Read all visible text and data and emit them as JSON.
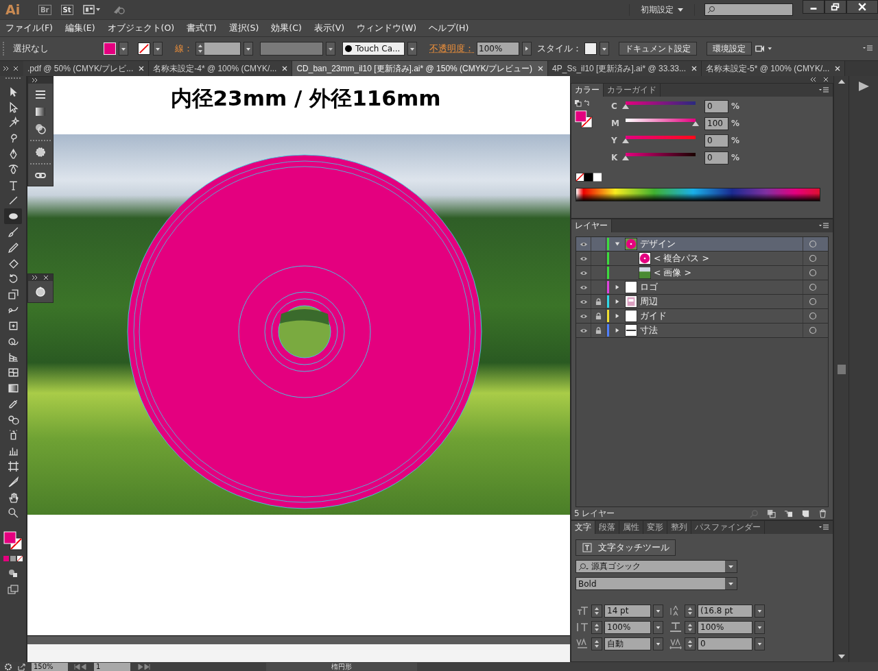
{
  "app_bar": {
    "logo": "Ai",
    "apps": [
      "Br",
      "St"
    ],
    "workspace": "初期設定"
  },
  "menu": [
    "ファイル(F)",
    "編集(E)",
    "オブジェクト(O)",
    "書式(T)",
    "選択(S)",
    "効果(C)",
    "表示(V)",
    "ウィンドウ(W)",
    "ヘルプ(H)"
  ],
  "control_bar": {
    "selection": "選択なし",
    "stroke_label": "線：",
    "brush": "Touch Ca...",
    "opacity_label": "不透明度：",
    "opacity": "100%",
    "style_label": "スタイル：",
    "buttons": [
      "ドキュメント設定",
      "環境設定"
    ]
  },
  "doc_tabs": [
    {
      "label": ".pdf @ 50% (CMYK/プレビ...",
      "selected": false
    },
    {
      "label": "名称未設定-4* @ 100% (CMYK/...",
      "selected": false
    },
    {
      "label": "CD_ban_23mm_il10 [更新済み].ai* @ 150% (CMYK/プレビュー)",
      "selected": true
    },
    {
      "label": "4P_Ss_il10 [更新済み].ai* @ 33.33...",
      "selected": false
    },
    {
      "label": "名称未設定-5* @ 100% (CMYK/...",
      "selected": false
    }
  ],
  "artboard": {
    "title": "内径23mm / 外径116mm"
  },
  "color_panel": {
    "tabs": [
      {
        "label": "カラー",
        "selected": true
      },
      {
        "label": "カラーガイド",
        "selected": false
      }
    ],
    "channels": [
      {
        "name": "C",
        "level": 0,
        "value": "0",
        "unit": "%"
      },
      {
        "name": "M",
        "level": 1,
        "value": "100",
        "unit": "%"
      },
      {
        "name": "Y",
        "level": 0,
        "value": "0",
        "unit": "%"
      },
      {
        "name": "K",
        "level": 0,
        "value": "0",
        "unit": "%"
      }
    ]
  },
  "layers_panel": {
    "tab": "レイヤー",
    "layers": [
      {
        "name": "デザイン",
        "color": "#3cdc3c",
        "kind": "disc",
        "visible": true,
        "locked": false,
        "expanded": true,
        "selected": true,
        "children": [
          {
            "name": "< 複合パス >",
            "color": "#3cdc3c",
            "kind": "disc",
            "visible": true,
            "locked": false,
            "selected": false
          },
          {
            "name": "< 画像 >",
            "color": "#3cdc3c",
            "kind": "photo",
            "visible": true,
            "locked": false,
            "selected": false
          }
        ]
      },
      {
        "name": "ロゴ",
        "color": "#e040e0",
        "kind": "blank",
        "visible": true,
        "locked": false,
        "expanded": false,
        "selected": false
      },
      {
        "name": "周辺",
        "color": "#30d8e8",
        "kind": "page",
        "visible": true,
        "locked": true,
        "expanded": false,
        "selected": false
      },
      {
        "name": "ガイド",
        "color": "#f0e030",
        "kind": "blank",
        "visible": true,
        "locked": true,
        "expanded": false,
        "selected": false
      },
      {
        "name": "寸法",
        "color": "#4f7fff",
        "kind": "ruler",
        "visible": true,
        "locked": true,
        "expanded": false,
        "selected": false
      }
    ],
    "count": "5 レイヤー"
  },
  "character_panel": {
    "tabs": [
      {
        "label": "文字",
        "selected": true
      },
      {
        "label": "段落",
        "selected": false
      },
      {
        "label": "属性",
        "selected": false
      },
      {
        "label": "変形",
        "selected": false
      },
      {
        "label": "整列",
        "selected": false
      },
      {
        "label": "パスファインダー",
        "selected": false
      }
    ],
    "touch_tool": "文字タッチツール",
    "font": "源真ゴシック",
    "style": "Bold",
    "fields": [
      {
        "kind": "size",
        "value": "14 pt"
      },
      {
        "kind": "leading",
        "value": "(16.8 pt"
      },
      {
        "kind": "vscale",
        "value": "100%"
      },
      {
        "kind": "hscale",
        "value": "100%"
      },
      {
        "kind": "kerning",
        "value": "自動"
      },
      {
        "kind": "tracking",
        "value": "0"
      }
    ]
  },
  "status_bar": {
    "zoom": "150%",
    "page": "1",
    "tool": "楕円形"
  }
}
